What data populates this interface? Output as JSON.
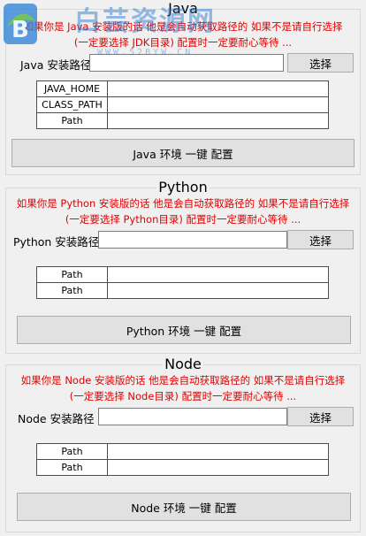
{
  "java": {
    "title": "Java",
    "notice_line1": "如果你是 Java 安装版的话 他是会自动获取路径的 如果不是请自行选择",
    "notice_line2": "(一定要选择 JDK目录) 配置时一定要耐心等待 ...",
    "path_label": "Java 安装路径",
    "path_value": "",
    "browse_label": "选择",
    "rows": [
      {
        "name": "JAVA_HOME",
        "value": ""
      },
      {
        "name": "CLASS_PATH",
        "value": ""
      },
      {
        "name": "Path",
        "value": ""
      }
    ],
    "configure_label": "Java 环境 一键 配置"
  },
  "python": {
    "title": "Python",
    "notice_line1": "如果你是 Python 安装版的话 他是会自动获取路径的 如果不是请自行选择",
    "notice_line2": "(一定要选择 Python目录) 配置时一定要耐心等待 ...",
    "path_label": "Python 安装路径",
    "path_value": "",
    "browse_label": "选择",
    "rows": [
      {
        "name": "Path",
        "value": ""
      },
      {
        "name": "Path",
        "value": ""
      }
    ],
    "configure_label": "Python 环境 一键 配置"
  },
  "node": {
    "title": "Node",
    "notice_line1": "如果你是 Node 安装版的话 他是会自动获取路径的 如果不是请自行选择",
    "notice_line2": "(一定要选择 Node目录) 配置时一定要耐心等待 ...",
    "path_label": "Node 安装路径",
    "path_value": "",
    "browse_label": "选择",
    "rows": [
      {
        "name": "Path",
        "value": ""
      },
      {
        "name": "Path",
        "value": ""
      }
    ],
    "configure_label": "Node 环境 一键 配置"
  },
  "watermark": {
    "text": "白芸资源网",
    "url": "WWW.52BYW.CN"
  }
}
